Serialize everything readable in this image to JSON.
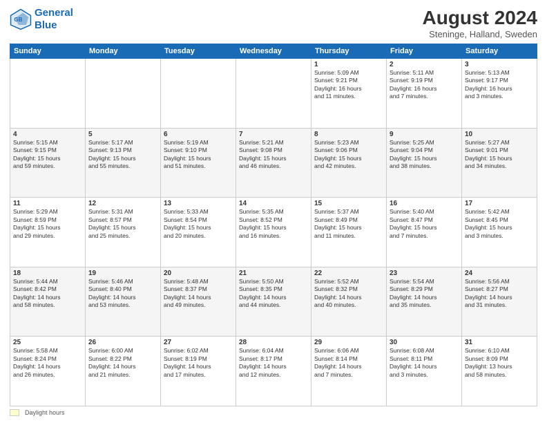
{
  "header": {
    "logo_line1": "General",
    "logo_line2": "Blue",
    "month_year": "August 2024",
    "location": "Steninge, Halland, Sweden"
  },
  "footer": {
    "daylight_label": "Daylight hours"
  },
  "days_of_week": [
    "Sunday",
    "Monday",
    "Tuesday",
    "Wednesday",
    "Thursday",
    "Friday",
    "Saturday"
  ],
  "weeks": [
    [
      {
        "num": "",
        "detail": ""
      },
      {
        "num": "",
        "detail": ""
      },
      {
        "num": "",
        "detail": ""
      },
      {
        "num": "",
        "detail": ""
      },
      {
        "num": "1",
        "detail": "Sunrise: 5:09 AM\nSunset: 9:21 PM\nDaylight: 16 hours\nand 11 minutes."
      },
      {
        "num": "2",
        "detail": "Sunrise: 5:11 AM\nSunset: 9:19 PM\nDaylight: 16 hours\nand 7 minutes."
      },
      {
        "num": "3",
        "detail": "Sunrise: 5:13 AM\nSunset: 9:17 PM\nDaylight: 16 hours\nand 3 minutes."
      }
    ],
    [
      {
        "num": "4",
        "detail": "Sunrise: 5:15 AM\nSunset: 9:15 PM\nDaylight: 15 hours\nand 59 minutes."
      },
      {
        "num": "5",
        "detail": "Sunrise: 5:17 AM\nSunset: 9:13 PM\nDaylight: 15 hours\nand 55 minutes."
      },
      {
        "num": "6",
        "detail": "Sunrise: 5:19 AM\nSunset: 9:10 PM\nDaylight: 15 hours\nand 51 minutes."
      },
      {
        "num": "7",
        "detail": "Sunrise: 5:21 AM\nSunset: 9:08 PM\nDaylight: 15 hours\nand 46 minutes."
      },
      {
        "num": "8",
        "detail": "Sunrise: 5:23 AM\nSunset: 9:06 PM\nDaylight: 15 hours\nand 42 minutes."
      },
      {
        "num": "9",
        "detail": "Sunrise: 5:25 AM\nSunset: 9:04 PM\nDaylight: 15 hours\nand 38 minutes."
      },
      {
        "num": "10",
        "detail": "Sunrise: 5:27 AM\nSunset: 9:01 PM\nDaylight: 15 hours\nand 34 minutes."
      }
    ],
    [
      {
        "num": "11",
        "detail": "Sunrise: 5:29 AM\nSunset: 8:59 PM\nDaylight: 15 hours\nand 29 minutes."
      },
      {
        "num": "12",
        "detail": "Sunrise: 5:31 AM\nSunset: 8:57 PM\nDaylight: 15 hours\nand 25 minutes."
      },
      {
        "num": "13",
        "detail": "Sunrise: 5:33 AM\nSunset: 8:54 PM\nDaylight: 15 hours\nand 20 minutes."
      },
      {
        "num": "14",
        "detail": "Sunrise: 5:35 AM\nSunset: 8:52 PM\nDaylight: 15 hours\nand 16 minutes."
      },
      {
        "num": "15",
        "detail": "Sunrise: 5:37 AM\nSunset: 8:49 PM\nDaylight: 15 hours\nand 11 minutes."
      },
      {
        "num": "16",
        "detail": "Sunrise: 5:40 AM\nSunset: 8:47 PM\nDaylight: 15 hours\nand 7 minutes."
      },
      {
        "num": "17",
        "detail": "Sunrise: 5:42 AM\nSunset: 8:45 PM\nDaylight: 15 hours\nand 3 minutes."
      }
    ],
    [
      {
        "num": "18",
        "detail": "Sunrise: 5:44 AM\nSunset: 8:42 PM\nDaylight: 14 hours\nand 58 minutes."
      },
      {
        "num": "19",
        "detail": "Sunrise: 5:46 AM\nSunset: 8:40 PM\nDaylight: 14 hours\nand 53 minutes."
      },
      {
        "num": "20",
        "detail": "Sunrise: 5:48 AM\nSunset: 8:37 PM\nDaylight: 14 hours\nand 49 minutes."
      },
      {
        "num": "21",
        "detail": "Sunrise: 5:50 AM\nSunset: 8:35 PM\nDaylight: 14 hours\nand 44 minutes."
      },
      {
        "num": "22",
        "detail": "Sunrise: 5:52 AM\nSunset: 8:32 PM\nDaylight: 14 hours\nand 40 minutes."
      },
      {
        "num": "23",
        "detail": "Sunrise: 5:54 AM\nSunset: 8:29 PM\nDaylight: 14 hours\nand 35 minutes."
      },
      {
        "num": "24",
        "detail": "Sunrise: 5:56 AM\nSunset: 8:27 PM\nDaylight: 14 hours\nand 31 minutes."
      }
    ],
    [
      {
        "num": "25",
        "detail": "Sunrise: 5:58 AM\nSunset: 8:24 PM\nDaylight: 14 hours\nand 26 minutes."
      },
      {
        "num": "26",
        "detail": "Sunrise: 6:00 AM\nSunset: 8:22 PM\nDaylight: 14 hours\nand 21 minutes."
      },
      {
        "num": "27",
        "detail": "Sunrise: 6:02 AM\nSunset: 8:19 PM\nDaylight: 14 hours\nand 17 minutes."
      },
      {
        "num": "28",
        "detail": "Sunrise: 6:04 AM\nSunset: 8:17 PM\nDaylight: 14 hours\nand 12 minutes."
      },
      {
        "num": "29",
        "detail": "Sunrise: 6:06 AM\nSunset: 8:14 PM\nDaylight: 14 hours\nand 7 minutes."
      },
      {
        "num": "30",
        "detail": "Sunrise: 6:08 AM\nSunset: 8:11 PM\nDaylight: 14 hours\nand 3 minutes."
      },
      {
        "num": "31",
        "detail": "Sunrise: 6:10 AM\nSunset: 8:09 PM\nDaylight: 13 hours\nand 58 minutes."
      }
    ]
  ]
}
